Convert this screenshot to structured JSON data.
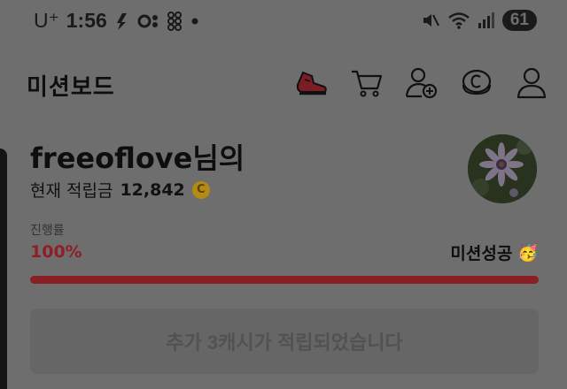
{
  "status_bar": {
    "carrier": "U⁺",
    "time": "1:56",
    "battery": "61"
  },
  "header": {
    "title": "미션보드",
    "icons": [
      "shoe-icon",
      "cart-icon",
      "add-friend-icon",
      "cash-coin-icon",
      "profile-icon"
    ]
  },
  "profile": {
    "username": "freeoflove님의",
    "points_label": "현재 적립금",
    "points_value": "12,842",
    "coin_symbol": "C"
  },
  "progress": {
    "label": "진행률",
    "value_text": "100%",
    "fraction": 1.0,
    "status": "미션성공",
    "status_emoji": "🥳"
  },
  "reward_button": {
    "label": "추가 3캐시가 적립되었습니다"
  },
  "colors": {
    "progress_fill": "#8a1f25",
    "progress_text": "#8f1f26",
    "coin": "#b38b12"
  }
}
